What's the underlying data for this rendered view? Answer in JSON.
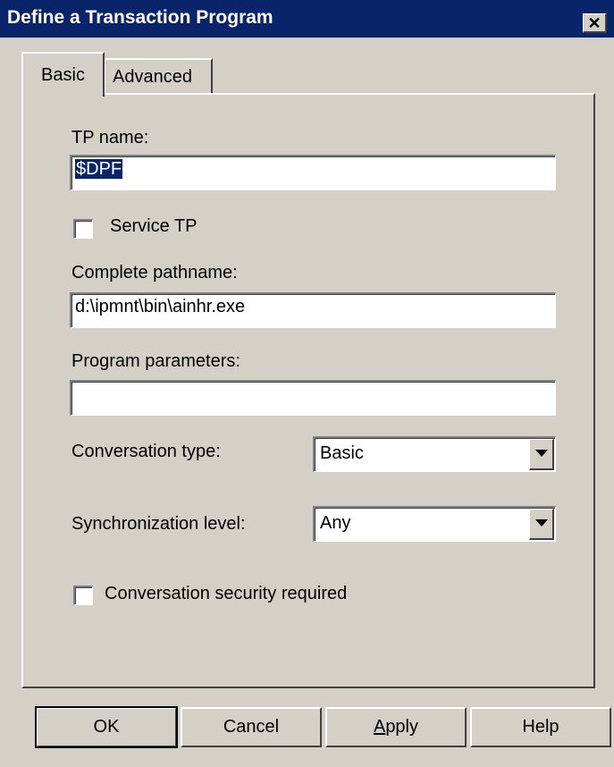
{
  "window": {
    "title": "Define a Transaction Program",
    "close_symbol": "✕"
  },
  "tabs": [
    {
      "label": "Basic",
      "active": true
    },
    {
      "label": "Advanced",
      "active": false
    }
  ],
  "form": {
    "tp_name_label": "TP name:",
    "tp_name_value": "$DPF",
    "service_tp_label": "Service TP",
    "service_tp_checked": false,
    "pathname_label": "Complete pathname:",
    "pathname_value": "d:\\ipmnt\\bin\\ainhr.exe",
    "parameters_label": "Program parameters:",
    "parameters_value": "",
    "conversation_type_label": "Conversation type:",
    "conversation_type_value": "Basic",
    "sync_level_label": "Synchronization level:",
    "sync_level_value": "Any",
    "security_label": "Conversation security required",
    "security_checked": false
  },
  "buttons": {
    "ok": "OK",
    "cancel": "Cancel",
    "apply": "Apply",
    "help": "Help"
  },
  "colors": {
    "titlebar": "#0a246a",
    "face": "#d4d0c8",
    "selection": "#0a246a"
  },
  "icons": {
    "close": "close-icon",
    "dropdown": "chevron-down-icon"
  }
}
